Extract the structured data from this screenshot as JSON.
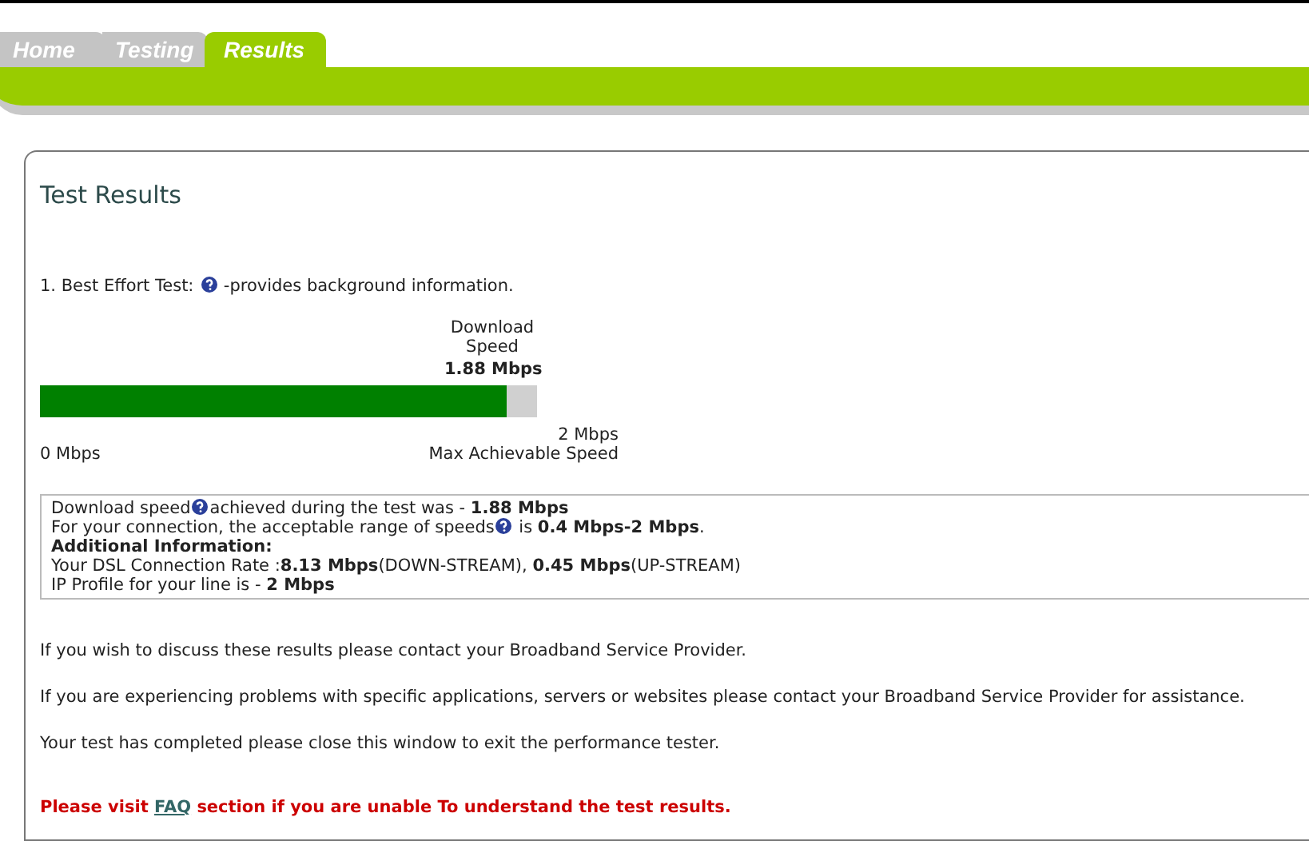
{
  "tabs": [
    {
      "label": "Home",
      "selected": false
    },
    {
      "label": "Testing",
      "selected": false
    },
    {
      "label": "Results",
      "selected": true
    }
  ],
  "title": "Test Results",
  "best_effort": {
    "text": "1. Best Effort Test:",
    "after": "-provides background information."
  },
  "meter": {
    "label": "Download Speed",
    "reading": "1.88 Mbps",
    "level": 0.94,
    "min_label": "0 Mbps",
    "max_label": "2 Mbps",
    "max_caption": "Max Achievable Speed"
  },
  "info_lines": [
    {
      "kind": "help",
      "text": "Download speed",
      "after": "achieved during the test was - **1.88 Mbps**"
    },
    {
      "kind": "help",
      "text": "For your connection, the acceptable range of speeds",
      "after": " is **0.4 Mbps-2 Mbps**."
    },
    {
      "kind": "heading",
      "text": "Additional Information:"
    },
    {
      "kind": "plain",
      "text": "Your DSL Connection Rate :**8.13 Mbps**(DOWN-STREAM), **0.45 Mbps**(UP-STREAM)"
    },
    {
      "kind": "plain",
      "text": "IP Profile for your line is - **2 Mbps**"
    }
  ],
  "paragraphs": [
    "If you wish to discuss these results please contact your Broadband Service Provider.",
    "If you are experiencing problems with specific applications, servers or websites please contact your Broadband Service Provider for assistance.",
    "Your test has completed please close this window to exit the performance tester."
  ],
  "notice": {
    "before": "Please visit",
    "link": "FAQ",
    "after": "section if you are unable To understand the test results."
  }
}
